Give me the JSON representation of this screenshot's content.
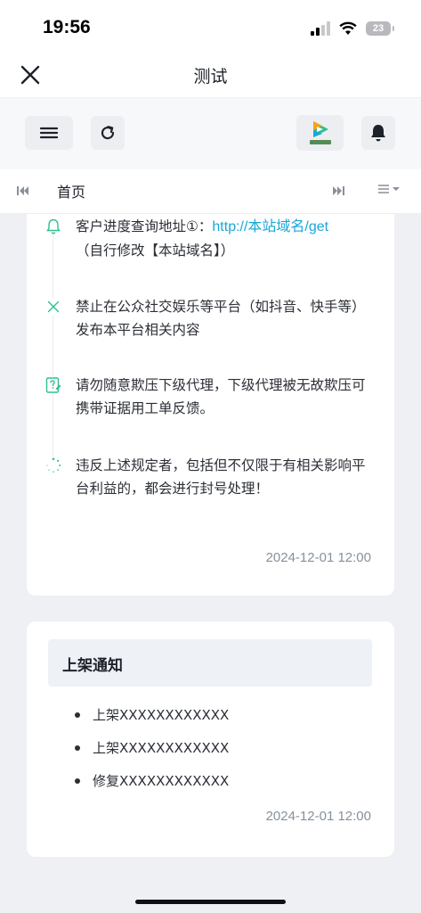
{
  "status_bar": {
    "time": "19:56",
    "battery": "23"
  },
  "nav": {
    "title": "测试"
  },
  "toolbar": {
    "app_icon": "tencent-video-icon",
    "app_label": "腾讯视频"
  },
  "tabs": {
    "home": "首页"
  },
  "notice": {
    "items": [
      {
        "icon": "bell-icon",
        "text": "客户进度查询地址①：",
        "link": "http://本站域名/get",
        "text2": "（自行修改【本站域名】）"
      },
      {
        "icon": "x-icon",
        "text": "禁止在公众社交娱乐等平台（如抖音、快手等）发布本平台相关内容"
      },
      {
        "icon": "edit-note-icon",
        "text": "请勿随意欺压下级代理，下级代理被无故欺压可携带证据用工单反馈。"
      },
      {
        "icon": "loading-icon",
        "text": "违反上述规定者，包括但不仅限于有相关影响平台利益的，都会进行封号处理！"
      }
    ],
    "date": "2024-12-01 12:00"
  },
  "shelf": {
    "title": "上架通知",
    "items": [
      "上架XXXXXXXXXXXX",
      "上架XXXXXXXXXXXX",
      "修复XXXXXXXXXXXX"
    ],
    "date": "2024-12-01 12:00"
  },
  "colors": {
    "accent": "#2ec08f",
    "link": "#1aa7d8",
    "muted": "#86909c"
  }
}
